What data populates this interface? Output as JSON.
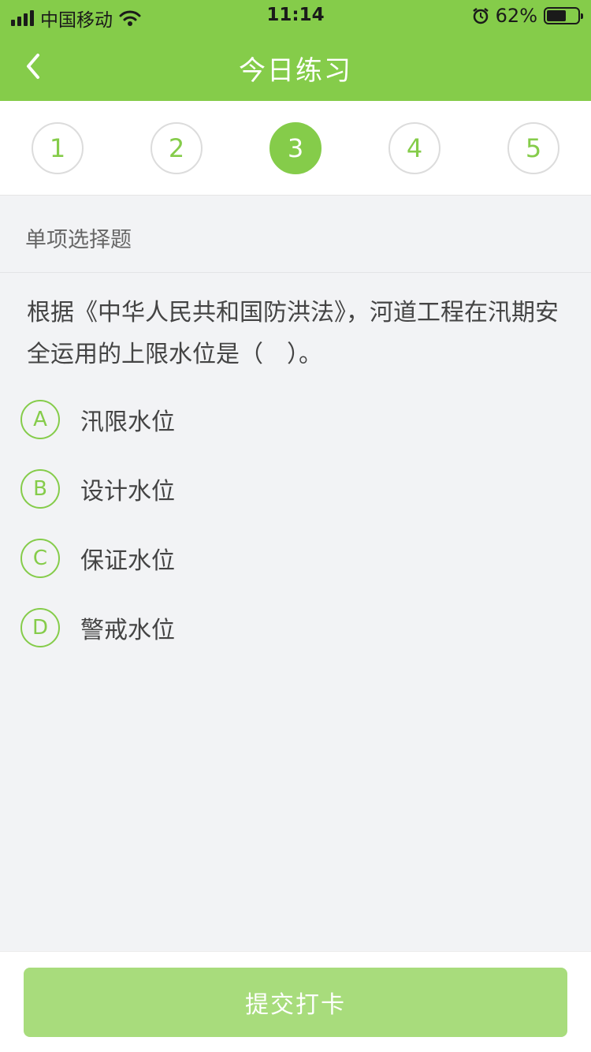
{
  "status_bar": {
    "carrier": "中国移动",
    "time": "11:14",
    "battery": "62%",
    "battery_level": 0.62
  },
  "nav": {
    "title": "今日练习",
    "back_icon": "chevron-left-icon"
  },
  "steps": {
    "items": [
      "1",
      "2",
      "3",
      "4",
      "5"
    ],
    "active_index": 2
  },
  "question": {
    "type": "单项选择题",
    "text": "根据《中华人民共和国防洪法》，河道工程在汛期安全运用的上限水位是（　）。",
    "options": [
      {
        "letter": "A",
        "text": "汛限水位"
      },
      {
        "letter": "B",
        "text": "设计水位"
      },
      {
        "letter": "C",
        "text": "保证水位"
      },
      {
        "letter": "D",
        "text": "警戒水位"
      }
    ]
  },
  "footer": {
    "submit_label": "提交打卡"
  },
  "colors": {
    "primary": "#85cc4a",
    "submit_disabled": "#a8dc7c",
    "background": "#f2f3f5"
  }
}
